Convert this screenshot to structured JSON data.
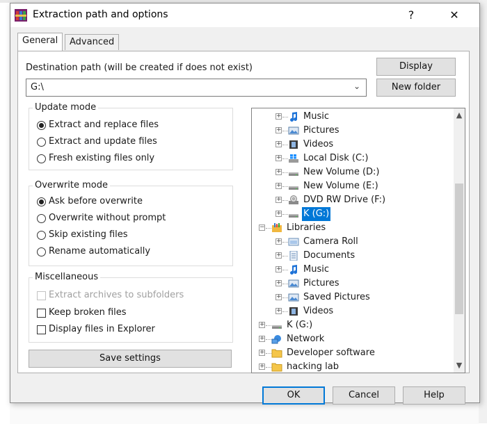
{
  "dialog": {
    "title": "Extraction path and options",
    "help_glyph": "?",
    "close_glyph": "✕"
  },
  "tabs": [
    {
      "label": "General",
      "active": true
    },
    {
      "label": "Advanced",
      "active": false
    }
  ],
  "destination": {
    "label": "Destination path (will be created if does not exist)",
    "value": "G:\\",
    "display_button": "Display",
    "new_folder_button": "New folder"
  },
  "update_mode": {
    "title": "Update mode",
    "options": [
      {
        "label": "Extract and replace files",
        "selected": true
      },
      {
        "label": "Extract and update files",
        "selected": false
      },
      {
        "label": "Fresh existing files only",
        "selected": false
      }
    ]
  },
  "overwrite_mode": {
    "title": "Overwrite mode",
    "options": [
      {
        "label": "Ask before overwrite",
        "selected": true
      },
      {
        "label": "Overwrite without prompt",
        "selected": false
      },
      {
        "label": "Skip existing files",
        "selected": false
      },
      {
        "label": "Rename automatically",
        "selected": false
      }
    ]
  },
  "miscellaneous": {
    "title": "Miscellaneous",
    "options": [
      {
        "label": "Extract archives to subfolders",
        "checked": false,
        "disabled": true
      },
      {
        "label": "Keep broken files",
        "checked": false,
        "disabled": false
      },
      {
        "label": "Display files in Explorer",
        "checked": false,
        "disabled": false
      }
    ]
  },
  "save_settings_button": "Save settings",
  "tree": {
    "items": [
      {
        "label": "Music",
        "icon": "music-icon"
      },
      {
        "label": "Pictures",
        "icon": "pictures-icon"
      },
      {
        "label": "Videos",
        "icon": "videos-icon"
      },
      {
        "label": "Local Disk (C:)",
        "icon": "windows-drive-icon"
      },
      {
        "label": "New Volume (D:)",
        "icon": "drive-icon"
      },
      {
        "label": "New Volume (E:)",
        "icon": "drive-icon"
      },
      {
        "label": "DVD RW Drive (F:)",
        "icon": "dvd-drive-icon"
      },
      {
        "label": "K (G:)",
        "icon": "drive-icon",
        "selected": true
      },
      {
        "label": "Libraries",
        "icon": "libraries-icon"
      },
      {
        "label": "Camera Roll",
        "icon": "library-folder-icon"
      },
      {
        "label": "Documents",
        "icon": "documents-icon"
      },
      {
        "label": "Music",
        "icon": "music-icon"
      },
      {
        "label": "Pictures",
        "icon": "pictures-icon"
      },
      {
        "label": "Saved Pictures",
        "icon": "pictures-icon"
      },
      {
        "label": "Videos",
        "icon": "videos-icon"
      },
      {
        "label": "K (G:)",
        "icon": "drive-icon"
      },
      {
        "label": "Network",
        "icon": "network-icon"
      },
      {
        "label": "Developer software",
        "icon": "folder-icon"
      },
      {
        "label": "hacking lab",
        "icon": "folder-icon"
      }
    ],
    "scroll_up": "▲",
    "scroll_down": "▼"
  },
  "footer": {
    "ok": "OK",
    "cancel": "Cancel",
    "help": "Help"
  },
  "colors": {
    "selection": "#0078d7",
    "dialog_bg": "#f0f0f0",
    "folder_yellow": "#f5c64a"
  }
}
